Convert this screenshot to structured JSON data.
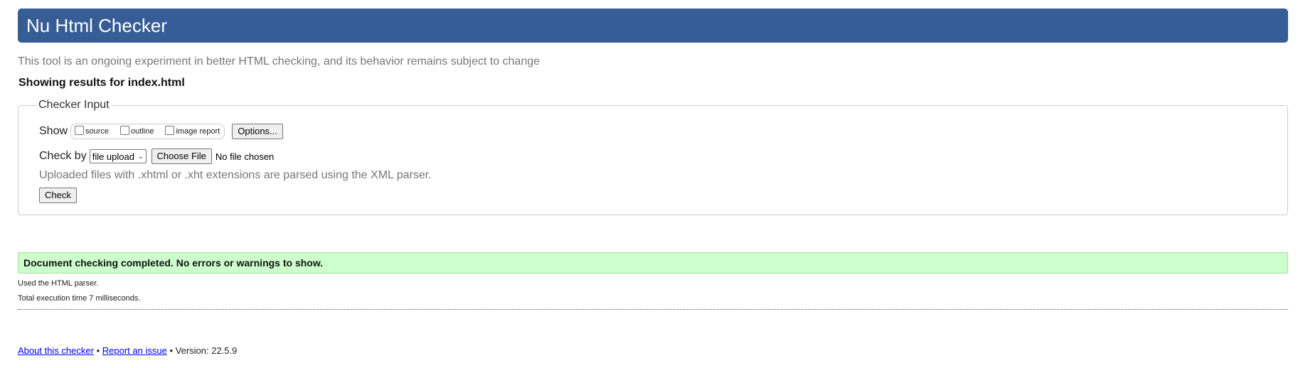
{
  "header": {
    "title": "Nu Html Checker"
  },
  "tagline": "This tool is an ongoing experiment in better HTML checking, and its behavior remains subject to change",
  "results_for": "Showing results for index.html",
  "checker_input": {
    "legend": "Checker Input",
    "show_label": "Show",
    "show_options": [
      {
        "label": "source",
        "checked": false
      },
      {
        "label": "outline",
        "checked": false
      },
      {
        "label": "image report",
        "checked": false
      }
    ],
    "options_button": "Options...",
    "check_by_label": "Check by",
    "check_by_selected": "file upload",
    "choose_file_button": "Choose File",
    "no_file_text": "No file chosen",
    "note": "Uploaded files with .xhtml or .xht extensions are parsed using the XML parser.",
    "check_button": "Check"
  },
  "result": {
    "message": "Document checking completed. No errors or warnings to show.",
    "used_parser": "Used the HTML parser.",
    "execution_time": "Total execution time 7 milliseconds."
  },
  "footer": {
    "about_link": "About this checker",
    "separator": "•",
    "report_link": "Report an issue",
    "version": "Version: 22.5.9"
  },
  "colors": {
    "header_bg": "#365d95",
    "success_bg": "#ccffcc",
    "link": "#0000ee",
    "muted_text": "#777777"
  }
}
